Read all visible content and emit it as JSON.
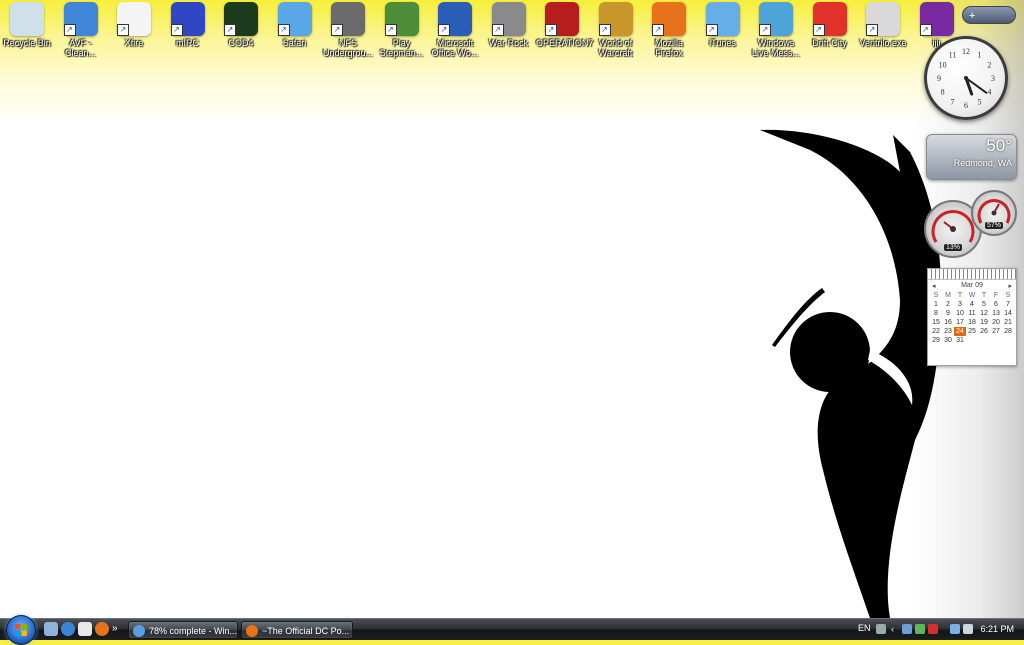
{
  "desktop_icons": [
    {
      "label": "Recycle Bin",
      "icon": "recycle-bin-icon",
      "color": "#cfe0ea",
      "shortcut": false
    },
    {
      "label": "AVF -Clean...",
      "icon": "avg-clean-icon",
      "color": "#3f86d8",
      "shortcut": true
    },
    {
      "label": "Xfire",
      "icon": "xfire-icon",
      "color": "#f4f4f4",
      "shortcut": true
    },
    {
      "label": "mIRC",
      "icon": "mirc-icon",
      "color": "#3046c4",
      "shortcut": true
    },
    {
      "label": "COD4",
      "icon": "cod4-icon",
      "color": "#1c3a1c",
      "shortcut": true
    },
    {
      "label": "Safari",
      "icon": "safari-icon",
      "color": "#5aa7e8",
      "shortcut": true
    },
    {
      "label": "NFS Undergrou...",
      "icon": "nfs-icon",
      "color": "#6b6b6b",
      "shortcut": true
    },
    {
      "label": "Play Stepman...",
      "icon": "stepmania-icon",
      "color": "#4d8d3a",
      "shortcut": true
    },
    {
      "label": "Microsoft Office Wo...",
      "icon": "word-icon",
      "color": "#2a5db8",
      "shortcut": true
    },
    {
      "label": "War Rock",
      "icon": "war-rock-icon",
      "color": "#8a8a8a",
      "shortcut": true
    },
    {
      "label": "OPERATION7",
      "icon": "operation7-icon",
      "color": "#b81d1d",
      "shortcut": true
    },
    {
      "label": "World of Warcraft",
      "icon": "wow-icon",
      "color": "#c8962b",
      "shortcut": true
    },
    {
      "label": "Mozilla Firefox",
      "icon": "firefox-icon",
      "color": "#e8721c",
      "shortcut": true
    },
    {
      "label": "iTunes",
      "icon": "itunes-icon",
      "color": "#66aee8",
      "shortcut": true
    },
    {
      "label": "Windows Live Mess...",
      "icon": "messenger-icon",
      "color": "#4ea3d8",
      "shortcut": true
    },
    {
      "label": "Drift City",
      "icon": "drift-city-icon",
      "color": "#e0312b",
      "shortcut": true
    },
    {
      "label": "Ventrilo.exe",
      "icon": "ventrilo-icon",
      "color": "#d9d9d9",
      "shortcut": true
    },
    {
      "label": "ijji",
      "icon": "ijji-icon",
      "color": "#7a2aa0",
      "shortcut": true
    }
  ],
  "gadgets": {
    "toolbar_plus": "+",
    "clock": {
      "hour": 5,
      "minute": 21
    },
    "weather": {
      "temp": "50°",
      "city": "Redmond, WA"
    },
    "meters": {
      "cpu_pct": "13%",
      "mem_pct": "57%"
    },
    "calendar": {
      "month": "Mar 09",
      "prev": "◂",
      "next": "▸",
      "dow": [
        "S",
        "M",
        "T",
        "W",
        "T",
        "F",
        "S"
      ],
      "weeks": [
        [
          "1",
          "2",
          "3",
          "4",
          "5",
          "6",
          "7"
        ],
        [
          "8",
          "9",
          "10",
          "11",
          "12",
          "13",
          "14"
        ],
        [
          "15",
          "16",
          "17",
          "18",
          "19",
          "20",
          "21"
        ],
        [
          "22",
          "23",
          "24",
          "25",
          "26",
          "27",
          "28"
        ],
        [
          "29",
          "30",
          "31",
          "",
          "",
          "",
          ""
        ]
      ],
      "today": "24"
    }
  },
  "taskbar": {
    "quick_launch": [
      "show-desktop-icon",
      "ie-icon",
      "messenger-quick-icon",
      "firefox-quick-icon"
    ],
    "overflow": "»",
    "tasks": [
      {
        "label": "78% complete - Win...",
        "icon": "download-icon",
        "color": "#5aa0e0"
      },
      {
        "label": "~The Official DC Po...",
        "icon": "firefox-task-icon",
        "color": "#e8721c"
      }
    ],
    "tray": {
      "language": "EN",
      "time": "6:21 PM"
    }
  },
  "colors": {
    "accent_yellow": "#f7ef3a",
    "taskbar": "#1b1e22"
  }
}
